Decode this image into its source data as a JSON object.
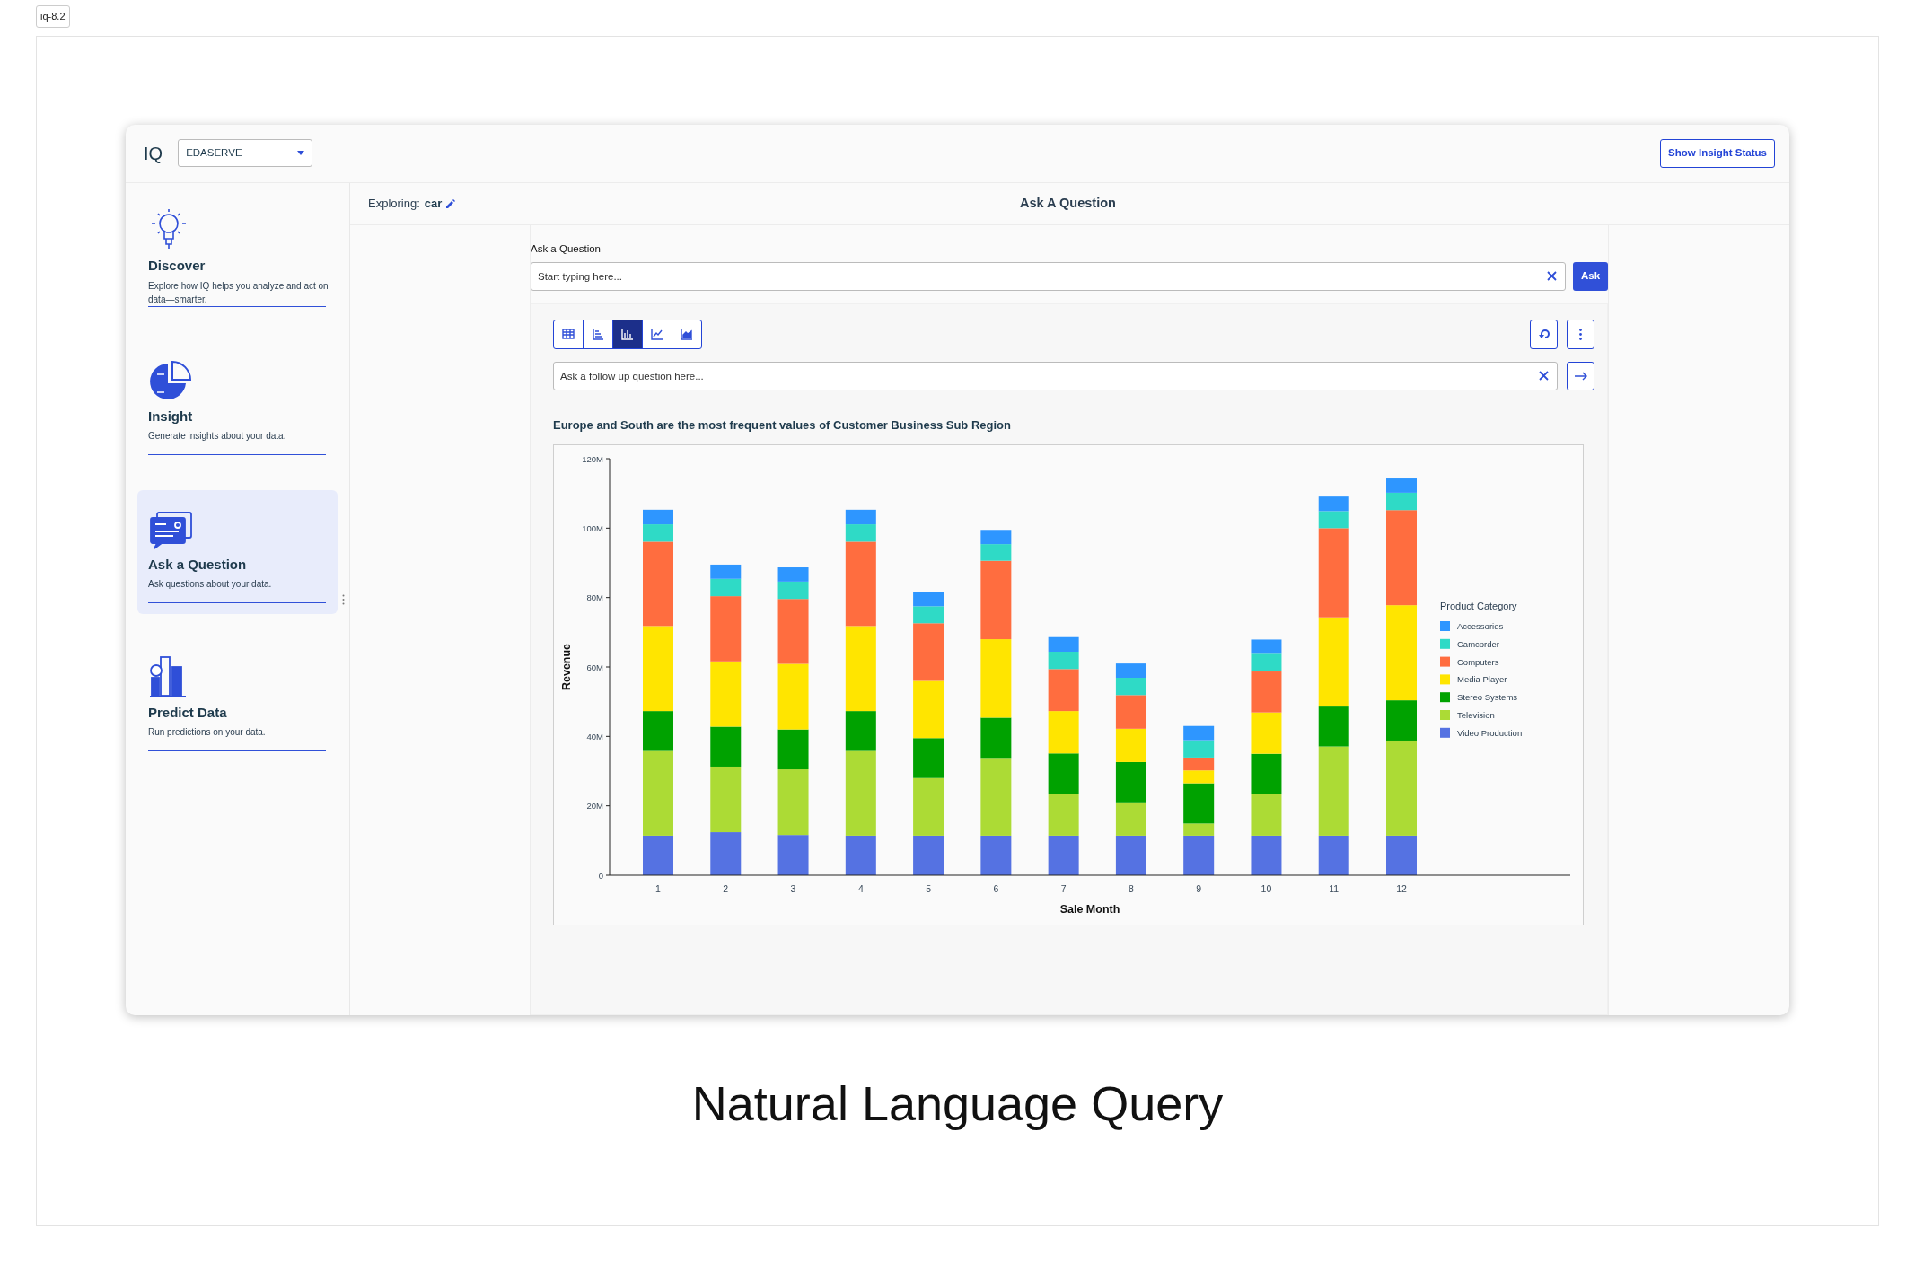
{
  "tag": "iq-8.2",
  "app": {
    "logo": "IQ",
    "workspace_select": {
      "value": "EDASERVE"
    },
    "header_button": "Show Insight Status",
    "sidebar": {
      "items": [
        {
          "kind": "discover",
          "title": "Discover",
          "description": "Explore how IQ helps you analyze and act on data—smarter.",
          "selected": false
        },
        {
          "kind": "insight",
          "title": "Insight",
          "description": "Generate insights about your data.",
          "selected": false
        },
        {
          "kind": "ask",
          "title": "Ask a Question",
          "description": "Ask questions about your data.",
          "selected": true
        },
        {
          "kind": "predict",
          "title": "Predict Data",
          "description": "Run predictions on your data.",
          "selected": false
        }
      ]
    },
    "exploring": {
      "label": "Exploring:",
      "value": "car"
    },
    "page_title": "Ask A Question",
    "question": {
      "label": "Ask a Question",
      "placeholder": "Start typing here...",
      "button": "Ask"
    },
    "view_toolbar": [
      {
        "kind": "table",
        "selected": false
      },
      {
        "kind": "bar-horizontal",
        "selected": false
      },
      {
        "kind": "bar",
        "selected": true
      },
      {
        "kind": "line",
        "selected": false
      },
      {
        "kind": "area",
        "selected": false
      }
    ],
    "follow_up": {
      "placeholder": "Ask a follow up question here..."
    },
    "insight_title": "Europe and South are the most frequent values of Customer Business Sub Region",
    "chart_data": {
      "type": "bar",
      "stacked": true,
      "xlabel": "Sale Month",
      "ylabel": "Revenue",
      "legend": {
        "title": "Product Category"
      },
      "categories": [
        "1",
        "2",
        "3",
        "4",
        "5",
        "6",
        "7",
        "8",
        "9",
        "10",
        "11",
        "12"
      ],
      "yticks": [
        {
          "value": 0,
          "label": "0"
        },
        {
          "value": 20,
          "label": "20M"
        },
        {
          "value": 40,
          "label": "40M"
        },
        {
          "value": 60,
          "label": "60M"
        },
        {
          "value": 80,
          "label": "80M"
        },
        {
          "value": 100,
          "label": "100M"
        },
        {
          "value": 120,
          "label": "120M"
        }
      ],
      "ylim": [
        0,
        120
      ],
      "series": [
        {
          "name": "Accessories",
          "color": "#2e96ff",
          "values": [
            4.2,
            4.1,
            4.1,
            4.2,
            4.1,
            4.1,
            4.2,
            4.1,
            4.1,
            4.1,
            4.2,
            4.1
          ]
        },
        {
          "name": "Camcorder",
          "color": "#2fdac6",
          "values": [
            5.0,
            5.0,
            5.0,
            5.0,
            4.9,
            4.8,
            5.0,
            5.0,
            5.0,
            5.1,
            4.9,
            5.0
          ]
        },
        {
          "name": "Computers",
          "color": "#ff6d3f",
          "values": [
            24.3,
            18.8,
            18.7,
            24.3,
            16.6,
            22.6,
            12.1,
            9.7,
            3.7,
            11.8,
            25.7,
            27.4
          ]
        },
        {
          "name": "Media Player",
          "color": "#ffe500",
          "values": [
            24.5,
            18.8,
            18.9,
            24.5,
            16.5,
            22.6,
            12.2,
            9.6,
            3.7,
            11.9,
            25.7,
            27.4
          ]
        },
        {
          "name": "Stereo Systems",
          "color": "#00a200",
          "values": [
            11.5,
            11.5,
            11.5,
            11.5,
            11.5,
            11.6,
            11.6,
            11.6,
            11.6,
            11.6,
            11.5,
            11.6
          ]
        },
        {
          "name": "Television",
          "color": "#acdb35",
          "values": [
            24.4,
            18.9,
            18.9,
            24.4,
            16.6,
            22.4,
            12.1,
            9.6,
            3.5,
            12.0,
            25.7,
            27.4
          ]
        },
        {
          "name": "Video Production",
          "color": "#5572e2",
          "values": [
            11.4,
            12.4,
            11.6,
            11.4,
            11.4,
            11.4,
            11.4,
            11.4,
            11.4,
            11.4,
            11.4,
            11.4
          ]
        }
      ]
    }
  },
  "caption": "Natural Language Query"
}
